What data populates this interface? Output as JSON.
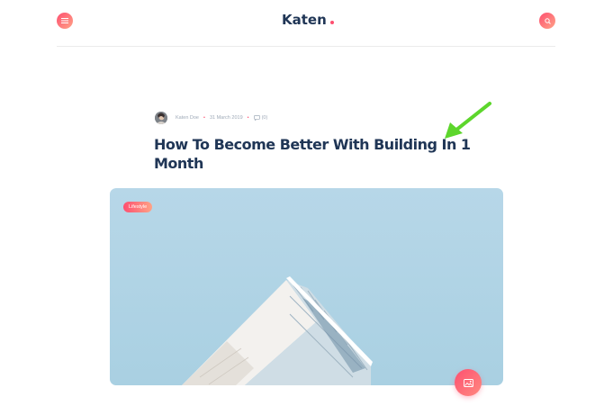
{
  "header": {
    "logo_text": "Katen",
    "menu_icon": "hamburger-icon",
    "search_icon": "search-icon"
  },
  "post": {
    "author": "Katen Doe",
    "date": "31 March 2019",
    "comments": "(0)",
    "title": "How To Become Better With Building In 1 Month",
    "category": "Lifestyle",
    "format_icon": "image-icon"
  },
  "colors": {
    "accent": "#FE4F70",
    "accent_light": "#FFA387",
    "heading": "#203656",
    "muted": "#9FAAB8",
    "annotation_arrow": "#5DD62C"
  }
}
